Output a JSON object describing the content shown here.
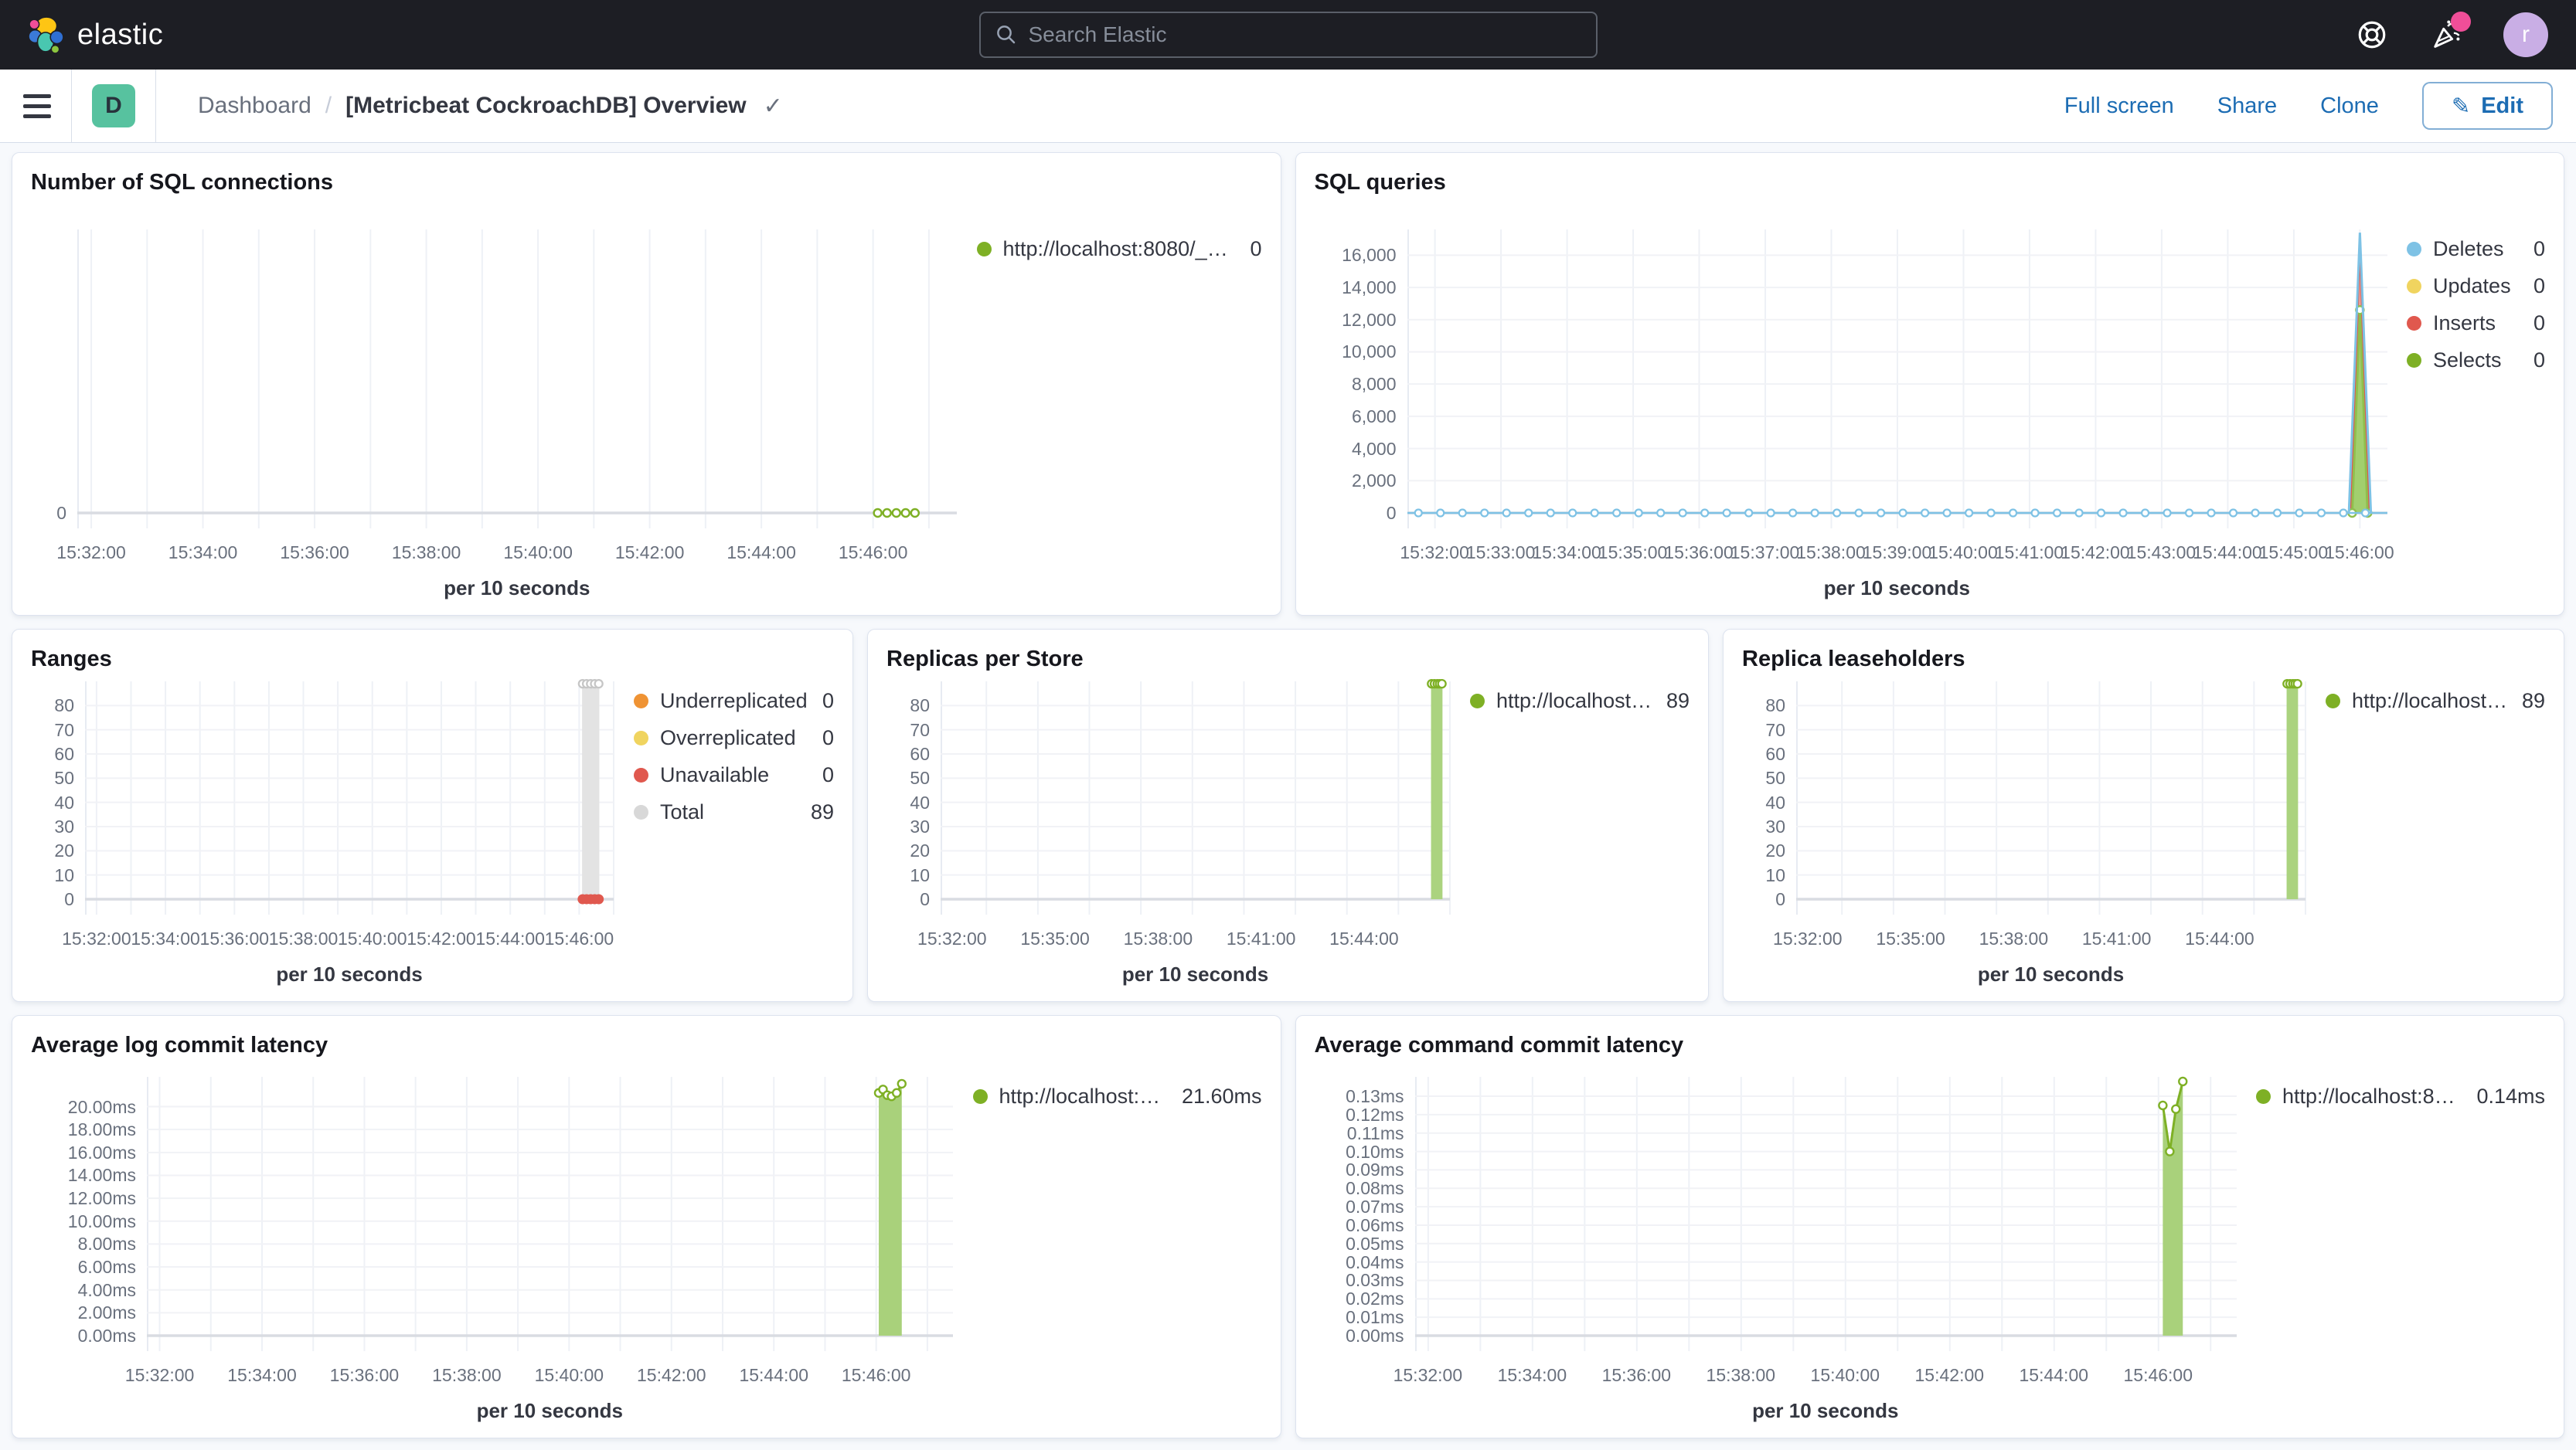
{
  "colors": {
    "accent_blue": "#1c6cb3",
    "header_bg": "#1d1e24",
    "page_bg": "#f7f9fc",
    "badge_teal": "#57c29f",
    "avatar_purple": "#c9aee5",
    "notification_pink": "#f04e98",
    "series_green": "#7eb025",
    "series_green_fill": "#a9d17b",
    "series_blue": "#7ec2e5",
    "series_yellow": "#f0d45f",
    "series_red": "#e0584e",
    "series_orange": "#ef9334",
    "series_gray": "#d8d8d8"
  },
  "header": {
    "brand": "elastic",
    "search_placeholder": "Search Elastic",
    "avatar_initial": "r"
  },
  "toolbar": {
    "badge_initial": "D",
    "breadcrumb_root": "Dashboard",
    "breadcrumb_sep": "/",
    "title": "[Metricbeat CockroachDB] Overview",
    "actions": {
      "fullscreen": "Full screen",
      "share": "Share",
      "clone": "Clone"
    },
    "edit_label": "Edit",
    "edit_icon": "✎"
  },
  "panels": [
    {
      "title": "Number of SQL connections",
      "x_axis_label": "per 10 seconds",
      "legend": [
        {
          "label": "http://localhost:8080/_stat...",
          "value": "0",
          "color": "#7eb025"
        }
      ],
      "chart": {
        "type": "line",
        "x_domain": [
          "15:31:45",
          "15:47:30"
        ],
        "grid_s": 60,
        "x_ticks": [
          "15:32:00",
          "15:34:00",
          "15:36:00",
          "15:38:00",
          "15:40:00",
          "15:42:00",
          "15:44:00",
          "15:46:00"
        ],
        "y_max": 1,
        "y_ticks": [
          {
            "label": "0",
            "v": 0
          }
        ],
        "series": [
          {
            "type": "line",
            "color": "#7eb025",
            "marker": "open",
            "points": [
              [
                "15:46:05",
                0
              ],
              [
                "15:46:15",
                0
              ],
              [
                "15:46:25",
                0
              ],
              [
                "15:46:35",
                0
              ],
              [
                "15:46:45",
                0
              ]
            ]
          }
        ]
      }
    },
    {
      "title": "SQL queries",
      "x_axis_label": "per 10 seconds",
      "legend": [
        {
          "label": "Deletes",
          "value": "0",
          "color": "#7ec2e5"
        },
        {
          "label": "Updates",
          "value": "0",
          "color": "#f0d45f"
        },
        {
          "label": "Inserts",
          "value": "0",
          "color": "#e0584e"
        },
        {
          "label": "Selects",
          "value": "0",
          "color": "#7eb025"
        }
      ],
      "chart": {
        "type": "line",
        "x_domain": [
          "15:31:35",
          "15:46:25"
        ],
        "grid_s": 60,
        "x_ticks": [
          "15:32:00",
          "15:33:00",
          "15:34:00",
          "15:35:00",
          "15:36:00",
          "15:37:00",
          "15:38:00",
          "15:39:00",
          "15:40:00",
          "15:41:00",
          "15:42:00",
          "15:43:00",
          "15:44:00",
          "15:45:00",
          "15:46:00"
        ],
        "y_max": 17600,
        "y_ticks": [
          {
            "label": "0",
            "v": 0
          },
          {
            "label": "2,000",
            "v": 2000
          },
          {
            "label": "4,000",
            "v": 4000
          },
          {
            "label": "6,000",
            "v": 6000
          },
          {
            "label": "8,000",
            "v": 8000
          },
          {
            "label": "10,000",
            "v": 10000
          },
          {
            "label": "12,000",
            "v": 12000
          },
          {
            "label": "14,000",
            "v": 14000
          },
          {
            "label": "16,000",
            "v": 16000
          }
        ],
        "series": [
          {
            "type": "area",
            "color": "#e0584e",
            "fill": "#eda79e",
            "points": [
              [
                "15:45:52",
                0
              ],
              [
                "15:46:00",
                17000
              ],
              [
                "15:46:08",
                0
              ]
            ]
          },
          {
            "type": "area",
            "color": "#8fbf4d",
            "fill": "#a2cf6e",
            "marker": "open",
            "points": [
              [
                "15:45:53",
                0
              ],
              [
                "15:46:00",
                12600
              ],
              [
                "15:46:07",
                0
              ]
            ]
          },
          {
            "type": "line",
            "color": "#7ec2e5",
            "points": [
              [
                "15:45:50",
                0
              ],
              [
                "15:46:00",
                17400
              ],
              [
                "15:46:10",
                0
              ]
            ]
          },
          {
            "type": "flatline",
            "color": "#7ec2e5",
            "marker": "open",
            "value": 0,
            "step_s": 20
          }
        ]
      }
    },
    {
      "title": "Ranges",
      "x_axis_label": "per 10 seconds",
      "legend": [
        {
          "label": "Underreplicated",
          "value": "0",
          "color": "#ef9334"
        },
        {
          "label": "Overreplicated",
          "value": "0",
          "color": "#f0d45f"
        },
        {
          "label": "Unavailable",
          "value": "0",
          "color": "#e0584e"
        },
        {
          "label": "Total",
          "value": "89",
          "color": "#d8d8d8"
        }
      ],
      "chart": {
        "type": "bar",
        "x_domain": [
          "15:31:40",
          "15:47:00"
        ],
        "grid_s": 60,
        "x_ticks": [
          "15:32:00",
          "15:34:00",
          "15:36:00",
          "15:38:00",
          "15:40:00",
          "15:42:00",
          "15:44:00",
          "15:46:00"
        ],
        "y_max": 90,
        "y_ticks": [
          {
            "label": "0",
            "v": 0
          },
          {
            "label": "10",
            "v": 10
          },
          {
            "label": "20",
            "v": 20
          },
          {
            "label": "30",
            "v": 30
          },
          {
            "label": "40",
            "v": 40
          },
          {
            "label": "50",
            "v": 50
          },
          {
            "label": "60",
            "v": 60
          },
          {
            "label": "70",
            "v": 70
          },
          {
            "label": "80",
            "v": 80
          }
        ],
        "series": [
          {
            "type": "bar",
            "color": "#e3e3e3",
            "from": "15:46:05",
            "to": "15:46:35",
            "value": 89,
            "marker_color": "#c6c6c6",
            "marker_times": [
              "15:46:06",
              "15:46:13",
              "15:46:20",
              "15:46:27",
              "15:46:34"
            ]
          },
          {
            "type": "dots",
            "color": "#e0584e",
            "points": [
              [
                "15:46:06",
                0
              ],
              [
                "15:46:13",
                0
              ],
              [
                "15:46:20",
                0
              ],
              [
                "15:46:27",
                0
              ],
              [
                "15:46:34",
                0
              ]
            ]
          }
        ]
      }
    },
    {
      "title": "Replicas per Store",
      "x_axis_label": "per 10 seconds",
      "legend": [
        {
          "label": "http://localhost:8080/_sta...",
          "value": "89",
          "color": "#7eb025"
        }
      ],
      "chart": {
        "type": "bar",
        "x_domain": [
          "15:31:40",
          "15:46:30"
        ],
        "grid_s": 90,
        "x_ticks": [
          "15:32:00",
          "15:35:00",
          "15:38:00",
          "15:41:00",
          "15:44:00"
        ],
        "y_max": 90,
        "y_ticks": [
          {
            "label": "0",
            "v": 0
          },
          {
            "label": "10",
            "v": 10
          },
          {
            "label": "20",
            "v": 20
          },
          {
            "label": "30",
            "v": 30
          },
          {
            "label": "40",
            "v": 40
          },
          {
            "label": "50",
            "v": 50
          },
          {
            "label": "60",
            "v": 60
          },
          {
            "label": "70",
            "v": 70
          },
          {
            "label": "80",
            "v": 80
          }
        ],
        "series": [
          {
            "type": "bar",
            "color": "#abd37f",
            "from": "15:45:57",
            "to": "15:46:17",
            "value": 89,
            "marker_color": "#7eb025",
            "marker_times": [
              "15:45:58",
              "15:46:03",
              "15:46:08",
              "15:46:12",
              "15:46:16"
            ]
          }
        ]
      }
    },
    {
      "title": "Replica leaseholders",
      "x_axis_label": "per 10 seconds",
      "legend": [
        {
          "label": "http://localhost:8080/_sta...",
          "value": "89",
          "color": "#7eb025"
        }
      ],
      "chart": {
        "type": "bar",
        "x_domain": [
          "15:31:40",
          "15:46:30"
        ],
        "grid_s": 90,
        "x_ticks": [
          "15:32:00",
          "15:35:00",
          "15:38:00",
          "15:41:00",
          "15:44:00"
        ],
        "y_max": 90,
        "y_ticks": [
          {
            "label": "0",
            "v": 0
          },
          {
            "label": "10",
            "v": 10
          },
          {
            "label": "20",
            "v": 20
          },
          {
            "label": "30",
            "v": 30
          },
          {
            "label": "40",
            "v": 40
          },
          {
            "label": "50",
            "v": 50
          },
          {
            "label": "60",
            "v": 60
          },
          {
            "label": "70",
            "v": 70
          },
          {
            "label": "80",
            "v": 80
          }
        ],
        "series": [
          {
            "type": "bar",
            "color": "#abd37f",
            "from": "15:45:57",
            "to": "15:46:17",
            "value": 89,
            "marker_color": "#7eb025",
            "marker_times": [
              "15:45:58",
              "15:46:03",
              "15:46:08",
              "15:46:12",
              "15:46:16"
            ]
          }
        ]
      }
    },
    {
      "title": "Average log commit latency",
      "x_axis_label": "per 10 seconds",
      "legend": [
        {
          "label": "http://localhost:808...",
          "value": "21.60ms",
          "color": "#7eb025"
        }
      ],
      "chart": {
        "type": "area",
        "x_domain": [
          "15:31:45",
          "15:47:30"
        ],
        "grid_s": 60,
        "x_ticks": [
          "15:32:00",
          "15:34:00",
          "15:36:00",
          "15:38:00",
          "15:40:00",
          "15:42:00",
          "15:44:00",
          "15:46:00"
        ],
        "y_max": 22.6,
        "y_ticks": [
          {
            "label": "0.00ms",
            "v": 0
          },
          {
            "label": "2.00ms",
            "v": 2
          },
          {
            "label": "4.00ms",
            "v": 4
          },
          {
            "label": "6.00ms",
            "v": 6
          },
          {
            "label": "8.00ms",
            "v": 8
          },
          {
            "label": "10.00ms",
            "v": 10
          },
          {
            "label": "12.00ms",
            "v": 12
          },
          {
            "label": "14.00ms",
            "v": 14
          },
          {
            "label": "16.00ms",
            "v": 16
          },
          {
            "label": "18.00ms",
            "v": 18
          },
          {
            "label": "20.00ms",
            "v": 20
          }
        ],
        "series": [
          {
            "type": "area",
            "color": "#7eb025",
            "fill": "#a9d17b",
            "marker": "open",
            "points": [
              [
                "15:46:03",
                21.2
              ],
              [
                "15:46:08",
                21.5
              ],
              [
                "15:46:13",
                21.0
              ],
              [
                "15:46:18",
                20.9
              ],
              [
                "15:46:24",
                21.2
              ],
              [
                "15:46:30",
                22.0
              ]
            ]
          }
        ]
      }
    },
    {
      "title": "Average command commit latency",
      "x_axis_label": "per 10 seconds",
      "legend": [
        {
          "label": "http://localhost:8080...",
          "value": "0.14ms",
          "color": "#7eb025"
        }
      ],
      "chart": {
        "type": "area",
        "x_domain": [
          "15:31:45",
          "15:47:30"
        ],
        "grid_s": 60,
        "x_ticks": [
          "15:32:00",
          "15:34:00",
          "15:36:00",
          "15:38:00",
          "15:40:00",
          "15:42:00",
          "15:44:00",
          "15:46:00"
        ],
        "y_max": 0.1405,
        "y_ticks": [
          {
            "label": "0.00ms",
            "v": 0.0
          },
          {
            "label": "0.01ms",
            "v": 0.01
          },
          {
            "label": "0.02ms",
            "v": 0.02
          },
          {
            "label": "0.03ms",
            "v": 0.03
          },
          {
            "label": "0.04ms",
            "v": 0.04
          },
          {
            "label": "0.05ms",
            "v": 0.05
          },
          {
            "label": "0.06ms",
            "v": 0.06
          },
          {
            "label": "0.07ms",
            "v": 0.07
          },
          {
            "label": "0.08ms",
            "v": 0.08
          },
          {
            "label": "0.09ms",
            "v": 0.09
          },
          {
            "label": "0.10ms",
            "v": 0.1
          },
          {
            "label": "0.11ms",
            "v": 0.11
          },
          {
            "label": "0.12ms",
            "v": 0.12
          },
          {
            "label": "0.13ms",
            "v": 0.13
          }
        ],
        "series": [
          {
            "type": "area",
            "color": "#7eb025",
            "fill": "#a9d17b",
            "marker": "open",
            "points": [
              [
                "15:46:05",
                0.125
              ],
              [
                "15:46:13",
                0.1
              ],
              [
                "15:46:20",
                0.123
              ],
              [
                "15:46:28",
                0.138
              ]
            ]
          }
        ]
      }
    }
  ]
}
